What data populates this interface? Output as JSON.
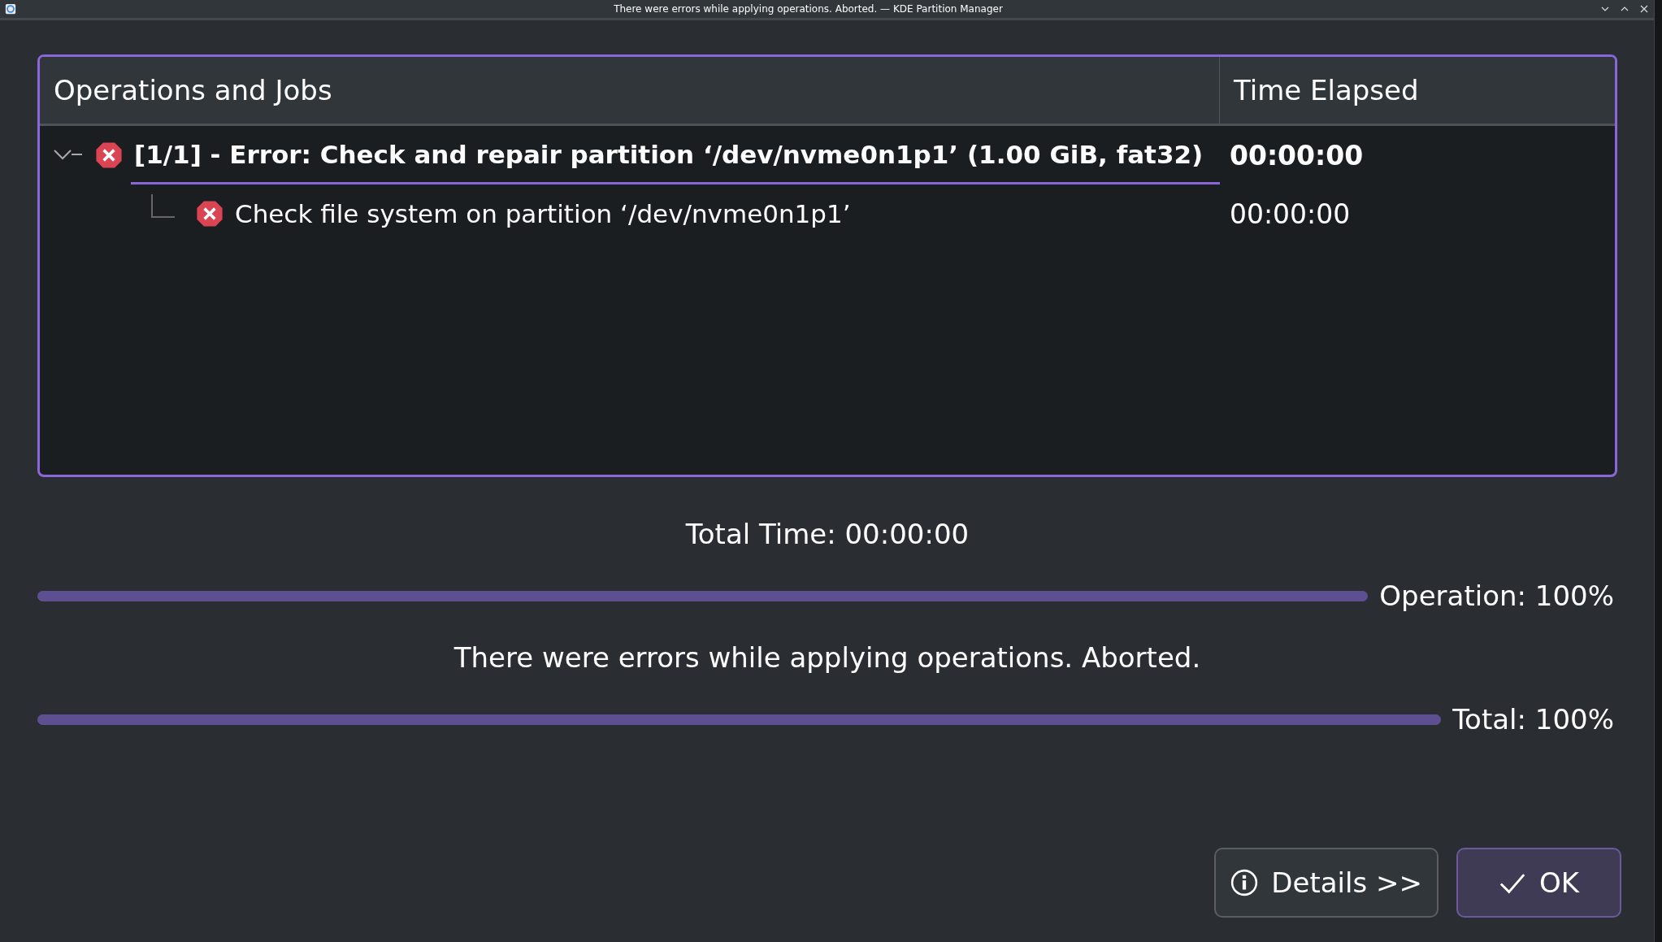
{
  "window": {
    "title": "There were errors while applying operations. Aborted. — KDE Partition Manager"
  },
  "tree": {
    "columns": [
      "Operations and Jobs",
      "Time Elapsed"
    ],
    "items": [
      {
        "kind": "error",
        "text": "[1/1] - Error: Check and repair partition ‘/dev/nvme0n1p1’ (1.00 GiB, fat32)",
        "time": "00:00:00",
        "selected": true,
        "expanded": true,
        "children": [
          {
            "kind": "error",
            "text": "Check file system on partition ‘/dev/nvme0n1p1’",
            "time": "00:00:00",
            "selected": false
          }
        ]
      }
    ]
  },
  "total_time": "Total Time: 00:00:00",
  "operation_progress": {
    "level": 1,
    "label": "Operation: 100%"
  },
  "message": "There were errors while applying operations. Aborted.",
  "total_progress": {
    "level": 1,
    "label": "Total: 100%"
  },
  "buttons": [
    {
      "kind": "info",
      "label": "Details >>"
    },
    {
      "kind": "ok",
      "label": "OK"
    }
  ]
}
